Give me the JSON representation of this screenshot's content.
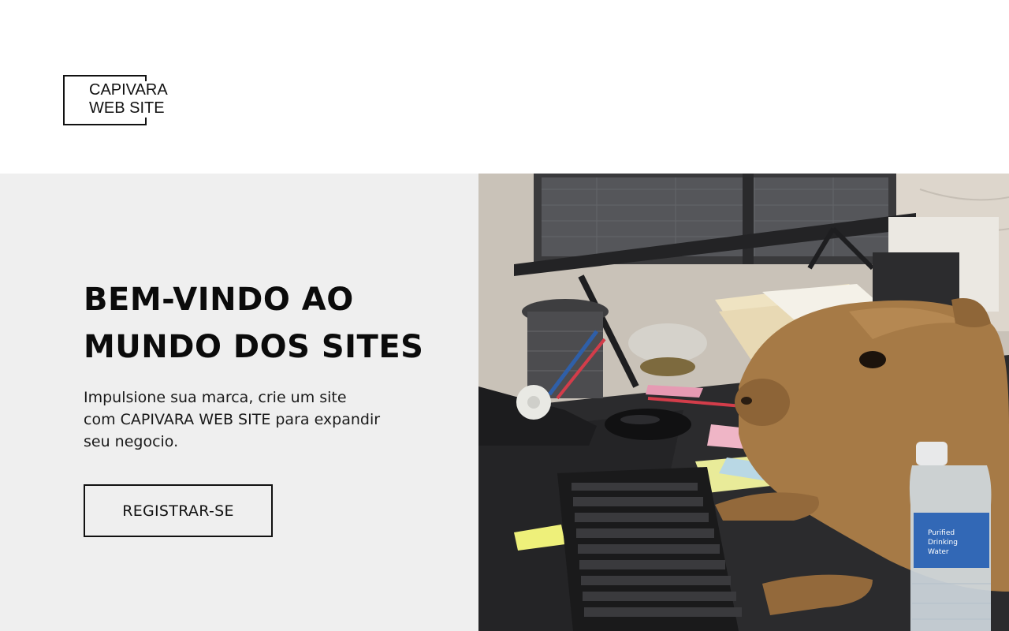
{
  "header": {
    "logo": {
      "line1": "CAPIVARA",
      "line2": "WEB SITE"
    }
  },
  "hero": {
    "title_line1": "BEM-VINDO AO",
    "title_line2": "MUNDO DOS SITES",
    "subtitle": "Impulsione sua marca, crie um site com CAPIVARA WEB SITE para expandir seu negocio.",
    "cta_label": "REGISTRAR-SE",
    "image": {
      "subject": "capybara-at-desk-photo",
      "bottle_label_line1": "Purified",
      "bottle_label_line2": "Drinking",
      "bottle_label_line3": "Water"
    }
  },
  "colors": {
    "hero_left_bg": "#efefef",
    "text": "#111111",
    "page_bg": "#ffffff"
  }
}
